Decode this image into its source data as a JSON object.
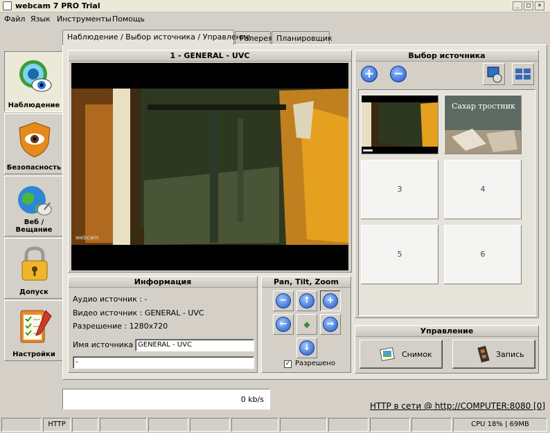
{
  "window": {
    "title": "webcam 7 PRO Trial",
    "minimize": "_",
    "maximize": "□",
    "close": "✕"
  },
  "menu": [
    "Файл",
    "Язык",
    "Инструменты",
    "Помощь"
  ],
  "tabs": [
    "Наблюдение / Выбор источника / Управление",
    "Галерея",
    "Планировщик"
  ],
  "sidebar": [
    {
      "label": "Наблюдение",
      "icon": "webcam-eye-icon"
    },
    {
      "label": "Безопасность",
      "icon": "shield-eye-icon"
    },
    {
      "label": "Веб / Вещание",
      "icon": "globe-satellite-icon"
    },
    {
      "label": "Допуск",
      "icon": "padlock-icon"
    },
    {
      "label": "Настройки",
      "icon": "checklist-icon"
    }
  ],
  "video": {
    "title": "1 - GENERAL - UVC",
    "watermark": "webcam"
  },
  "info": {
    "title": "Информация",
    "audio": "Аудио источник : -",
    "video": "Видео источник : GENERAL - UVC",
    "resolution": "Разрешение : 1280x720",
    "name_label": "Имя источника :",
    "name_value": "GENERAL - UVC",
    "extra_value": "-"
  },
  "ptz": {
    "title": "Pan, Tilt, Zoom",
    "enabled_label": "Разрешено",
    "enabled": true
  },
  "sources": {
    "title": "Выбор источника",
    "thumb2_caption": "Сахар тростник",
    "slots": [
      "3",
      "4",
      "5",
      "6"
    ]
  },
  "control": {
    "title": "Управление",
    "snapshot": "Снимок",
    "record": "Запись"
  },
  "bandwidth": "0 kb/s",
  "http_link": "HTTP в сети @ http://COMPUTER:8080 [0]",
  "status": {
    "http": "HTTP",
    "cpu": "CPU 18% | 69MB"
  },
  "colors": {
    "accent": "#1f58c8",
    "window_bg": "#d4d0c8"
  }
}
